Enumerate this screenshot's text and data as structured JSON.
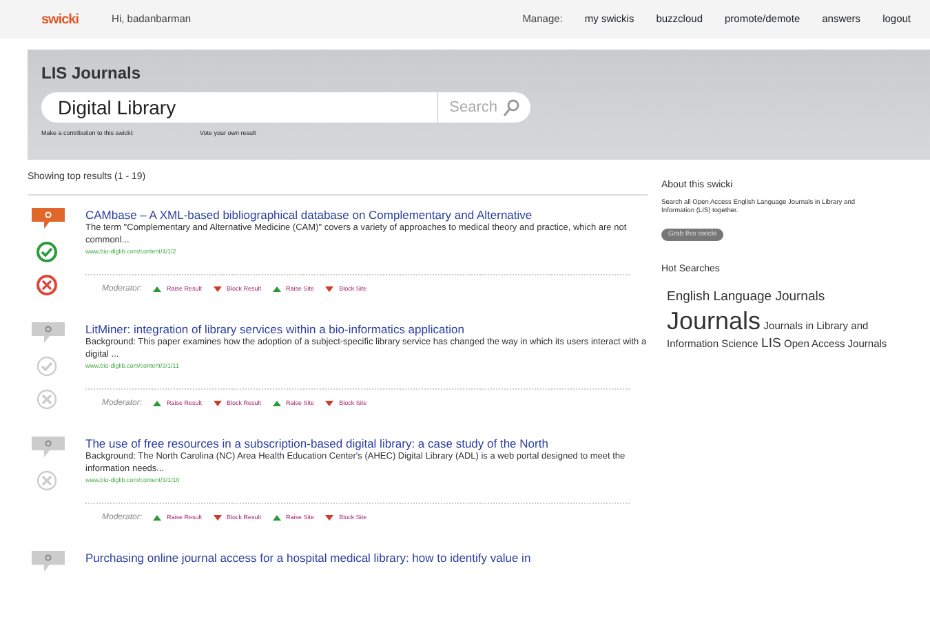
{
  "topbar": {
    "logo": "swicki",
    "greeting": "Hi, badanbarman",
    "manage_label": "Manage:",
    "links": [
      "my swickis",
      "buzzcloud",
      "promote/demote",
      "answers",
      "logout"
    ]
  },
  "header": {
    "title": "LIS Journals",
    "search_value": "Digital Library",
    "search_button": "Search",
    "sublinks": [
      "Make a contribution to this swicki:",
      "Vote your own result"
    ]
  },
  "results_heading": "Showing top results (1 - 19)",
  "results": [
    {
      "comment_active": true,
      "votes": [
        {
          "kind": "up",
          "active": true
        },
        {
          "kind": "down",
          "active": true
        }
      ],
      "title": "CAMbase – A XML-based bibliographical database on Complementary and Alternative",
      "snippet": "The term \"Complementary and Alternative Medicine (CAM)\" covers a variety of approaches to medical theory and practice, which are not commonl...",
      "url": "www.bio-diglib.com/content/4/1/2",
      "moderator_label": "Moderator:",
      "actions": [
        {
          "kind": "raise",
          "label": "Raise Result"
        },
        {
          "kind": "block",
          "label": "Block Result"
        },
        {
          "kind": "raise",
          "label": "Raise Site"
        },
        {
          "kind": "block",
          "label": "Block Site"
        }
      ]
    },
    {
      "comment_active": false,
      "votes": [
        {
          "kind": "up",
          "active": false
        },
        {
          "kind": "down",
          "active": false
        }
      ],
      "title": "LitMiner: integration of library services within a bio-informatics application",
      "snippet": "Background: This paper examines how the adoption of a subject-specific library service has changed the way in which its users interact with a digital ...",
      "url": "www.bio-diglib.com/content/3/1/11",
      "moderator_label": "Moderator:",
      "actions": [
        {
          "kind": "raise",
          "label": "Raise Result"
        },
        {
          "kind": "block",
          "label": "Block Result"
        },
        {
          "kind": "raise",
          "label": "Raise Site"
        },
        {
          "kind": "block",
          "label": "Block Site"
        }
      ]
    },
    {
      "comment_active": false,
      "votes": [
        {
          "kind": "down",
          "active": false
        }
      ],
      "title": "The use of free resources in a subscription-based digital library: a case study of the North",
      "snippet": "Background: The North Carolina (NC) Area Health Education Center's (AHEC) Digital Library (ADL) is a web portal designed to meet the information needs...",
      "url": "www.bio-diglib.com/content/3/1/10",
      "moderator_label": "Moderator:",
      "actions": [
        {
          "kind": "raise",
          "label": "Raise Result"
        },
        {
          "kind": "block",
          "label": "Block Result"
        },
        {
          "kind": "raise",
          "label": "Raise Site"
        },
        {
          "kind": "block",
          "label": "Block Site"
        }
      ]
    },
    {
      "comment_active": false,
      "title": "Purchasing online journal access for a hospital medical library: how to identify value in"
    }
  ],
  "sidebar": {
    "about_heading": "About this swicki",
    "about_text": "Search all Open Access English Language Journals in Library and Information (LIS) together.",
    "grab_button": "Grab this swicki",
    "hot_heading": "Hot Searches",
    "tags": [
      {
        "label": "English Language Journals",
        "kind": "medium"
      },
      {
        "label": "Journals",
        "kind": "large"
      },
      {
        "label": "Journals in Library and Information Science",
        "kind": "small"
      },
      {
        "label": "LIS",
        "kind": "medium"
      },
      {
        "label": "Open Access Journals",
        "kind": "small"
      }
    ]
  }
}
